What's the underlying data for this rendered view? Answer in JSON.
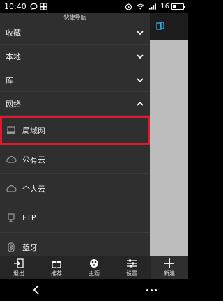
{
  "status": {
    "time": "10:40",
    "battery_level": "16"
  },
  "drawer": {
    "title": "快捷导航",
    "sections": [
      {
        "label": "收藏",
        "chevron": "down"
      },
      {
        "label": "本地",
        "chevron": "down"
      },
      {
        "label": "库",
        "chevron": "down"
      },
      {
        "label": "网络",
        "chevron": "up"
      }
    ],
    "network_items": [
      {
        "label": "局域网",
        "icon": "lan-icon",
        "highlighted": true
      },
      {
        "label": "公有云",
        "icon": "cloud-icon",
        "highlighted": false
      },
      {
        "label": "个人云",
        "icon": "cloud-icon",
        "highlighted": false
      },
      {
        "label": "FTP",
        "icon": "ftp-icon",
        "highlighted": false
      },
      {
        "label": "蓝牙",
        "icon": "bluetooth-icon",
        "highlighted": false
      }
    ]
  },
  "toolbar": {
    "exit": "退出",
    "recommend": "推荐",
    "theme": "主题",
    "settings": "设置",
    "new": "新建"
  },
  "colors": {
    "highlight": "#e0182b",
    "accent": "#2aa9e0"
  }
}
